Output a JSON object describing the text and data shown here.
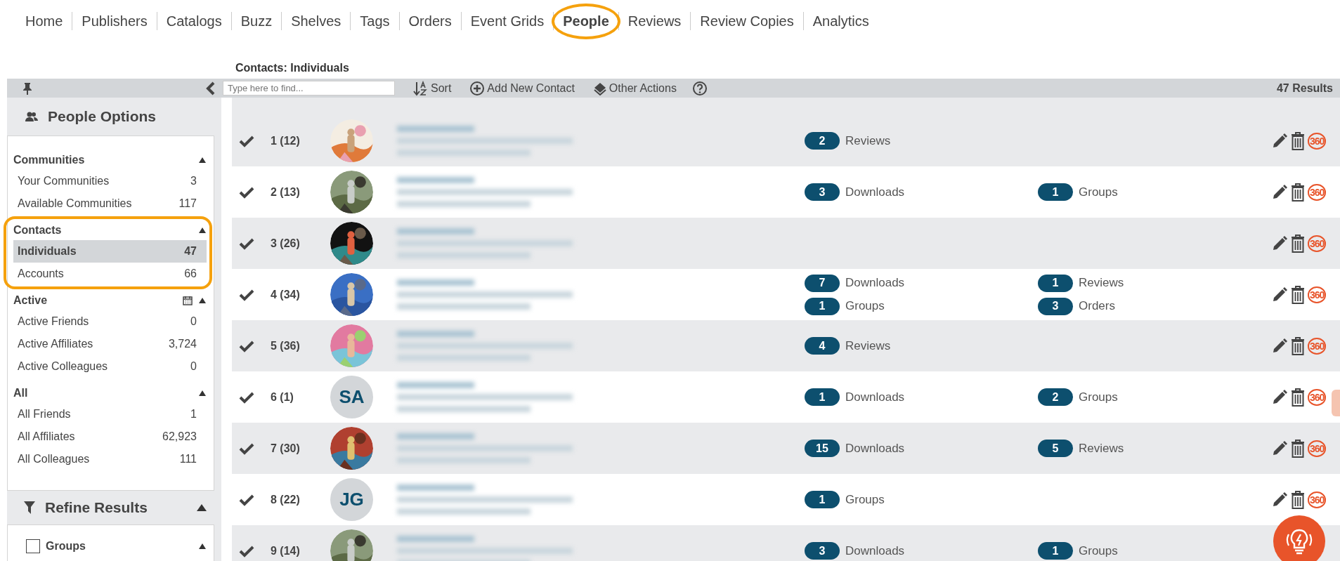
{
  "nav": [
    {
      "label": "Home",
      "selected": false
    },
    {
      "label": "Publishers",
      "selected": false
    },
    {
      "label": "Catalogs",
      "selected": false
    },
    {
      "label": "Buzz",
      "selected": false
    },
    {
      "label": "Shelves",
      "selected": false
    },
    {
      "label": "Tags",
      "selected": false
    },
    {
      "label": "Orders",
      "selected": false
    },
    {
      "label": "Event Grids",
      "selected": false
    },
    {
      "label": "People",
      "selected": true,
      "highlighted": true
    },
    {
      "label": "Reviews",
      "selected": false
    },
    {
      "label": "Review Copies",
      "selected": false
    },
    {
      "label": "Analytics",
      "selected": false
    }
  ],
  "page_title": "Contacts: Individuals",
  "toolbar": {
    "search_placeholder": "Type here to find...",
    "sort": "Sort",
    "add": "Add New Contact",
    "other": "Other Actions",
    "results": "47 Results"
  },
  "sidebar": {
    "title": "People Options",
    "sections": [
      {
        "title": "Communities",
        "items": [
          {
            "label": "Your Communities",
            "count": "3",
            "selected": false
          },
          {
            "label": "Available Communities",
            "count": "117",
            "selected": false
          }
        ]
      },
      {
        "title": "Contacts",
        "highlighted": true,
        "items": [
          {
            "label": "Individuals",
            "count": "47",
            "selected": true
          },
          {
            "label": "Accounts",
            "count": "66",
            "selected": false
          }
        ]
      },
      {
        "title": "Active",
        "calendar": true,
        "items": [
          {
            "label": "Active Friends",
            "count": "0",
            "selected": false
          },
          {
            "label": "Active Affiliates",
            "count": "3,724",
            "selected": false
          },
          {
            "label": "Active Colleagues",
            "count": "0",
            "selected": false
          }
        ]
      },
      {
        "title": "All",
        "items": [
          {
            "label": "All Friends",
            "count": "1",
            "selected": false
          },
          {
            "label": "All Affiliates",
            "count": "62,923",
            "selected": false
          },
          {
            "label": "All Colleagues",
            "count": "111",
            "selected": false
          }
        ]
      }
    ],
    "refine_title": "Refine Results",
    "filters": [
      {
        "label": "Groups",
        "checked": false
      }
    ]
  },
  "rows": [
    {
      "number": "1 (12)",
      "avatar": {
        "kind": "picture"
      },
      "stats": [
        {
          "count": "2",
          "label": "Reviews"
        }
      ],
      "view": "360"
    },
    {
      "number": "2 (13)",
      "avatar": {
        "kind": "picture"
      },
      "stats": [
        {
          "count": "3",
          "label": "Downloads"
        },
        {
          "count": "1",
          "label": "Groups"
        }
      ],
      "view": "360"
    },
    {
      "number": "3 (26)",
      "avatar": {
        "kind": "picture"
      },
      "stats": [],
      "view": "360"
    },
    {
      "number": "4 (34)",
      "avatar": {
        "kind": "picture"
      },
      "stats": [
        {
          "count": "7",
          "label": "Downloads"
        },
        {
          "count": "1",
          "label": "Reviews"
        },
        {
          "count": "1",
          "label": "Groups"
        },
        {
          "count": "3",
          "label": "Orders"
        }
      ],
      "view": "360"
    },
    {
      "number": "5 (36)",
      "avatar": {
        "kind": "picture"
      },
      "stats": [
        {
          "count": "4",
          "label": "Reviews"
        }
      ],
      "view": "360"
    },
    {
      "number": "6 (1)",
      "avatar": {
        "kind": "initials",
        "text": "SA"
      },
      "stats": [
        {
          "count": "1",
          "label": "Downloads"
        },
        {
          "count": "2",
          "label": "Groups"
        }
      ],
      "view": "360"
    },
    {
      "number": "7 (30)",
      "avatar": {
        "kind": "picture"
      },
      "stats": [
        {
          "count": "15",
          "label": "Downloads"
        },
        {
          "count": "5",
          "label": "Reviews"
        }
      ],
      "view": "360"
    },
    {
      "number": "8 (22)",
      "avatar": {
        "kind": "initials",
        "text": "JG"
      },
      "stats": [
        {
          "count": "1",
          "label": "Groups"
        }
      ],
      "view": "360"
    },
    {
      "number": "9 (14)",
      "avatar": {
        "kind": "picture"
      },
      "stats": [
        {
          "count": "3",
          "label": "Downloads"
        },
        {
          "count": "1",
          "label": "Groups"
        }
      ]
    }
  ]
}
